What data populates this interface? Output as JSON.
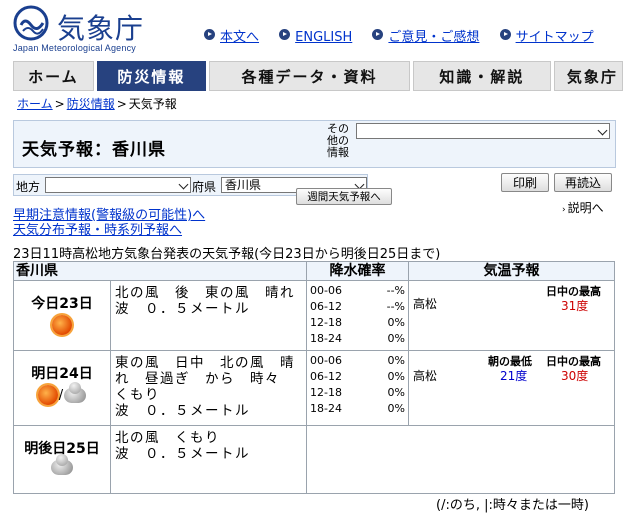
{
  "header": {
    "logo_text": "気象庁",
    "logo_sub": "Japan Meteorological Agency",
    "links": [
      "本文へ",
      "ENGLISH",
      "ご意見・ご感想",
      "サイトマップ"
    ]
  },
  "nav": {
    "tabs": [
      "ホーム",
      "防災情報",
      "各種データ・資料",
      "知識・解説",
      "気象庁"
    ]
  },
  "breadcrumb": [
    "ホーム",
    "防災情報",
    "天気予報"
  ],
  "title": "天気予報：香川県",
  "other_info_label": "その他の情報",
  "region": {
    "chiho_label": "地方",
    "chiho_value": "",
    "pref_label": "府県",
    "pref_value": "香川県"
  },
  "buttons": {
    "print": "印刷",
    "reload": "再読込",
    "explain": "説明へ",
    "weekly": "週間天気予報へ"
  },
  "links": {
    "early_warning": "早期注意情報(警報級の可能性)へ",
    "distribution": "天気分布予報・時系列予報へ"
  },
  "issued": "23日11時高松地方気象台発表の天気予報(今日23日から明後日25日まで)",
  "table": {
    "headers": {
      "pref": "香川県",
      "pop": "降水確率",
      "temp": "気温予報"
    },
    "days": [
      {
        "name": "今日23日",
        "weather": "北の風　後　東の風　晴れ",
        "wave": "波　０．５メートル",
        "pop": [
          [
            "00-06",
            "--%"
          ],
          [
            "06-12",
            "--%"
          ],
          [
            "12-18",
            "0%"
          ],
          [
            "18-24",
            "0%"
          ]
        ],
        "location": "高松",
        "min_label": "",
        "min_value": "",
        "max_label": "日中の最高",
        "max_value": "31度"
      },
      {
        "name": "明日24日",
        "weather": "東の風　日中　北の風　晴れ　昼過ぎ　から　時々　くもり",
        "wave": "波　０．５メートル",
        "pop": [
          [
            "00-06",
            "0%"
          ],
          [
            "06-12",
            "0%"
          ],
          [
            "12-18",
            "0%"
          ],
          [
            "18-24",
            "0%"
          ]
        ],
        "location": "高松",
        "min_label": "朝の最低",
        "min_value": "21度",
        "max_label": "日中の最高",
        "max_value": "30度"
      },
      {
        "name": "明後日25日",
        "weather": "北の風　くもり",
        "wave": "波　０．５メートル"
      }
    ],
    "icon_sep": "/"
  },
  "footnote": "(/:のち, |:時々または一時)",
  "icons": [
    "sun-icon",
    "cloud-icon",
    "arrow-right-icon",
    "chevron-down-icon"
  ]
}
